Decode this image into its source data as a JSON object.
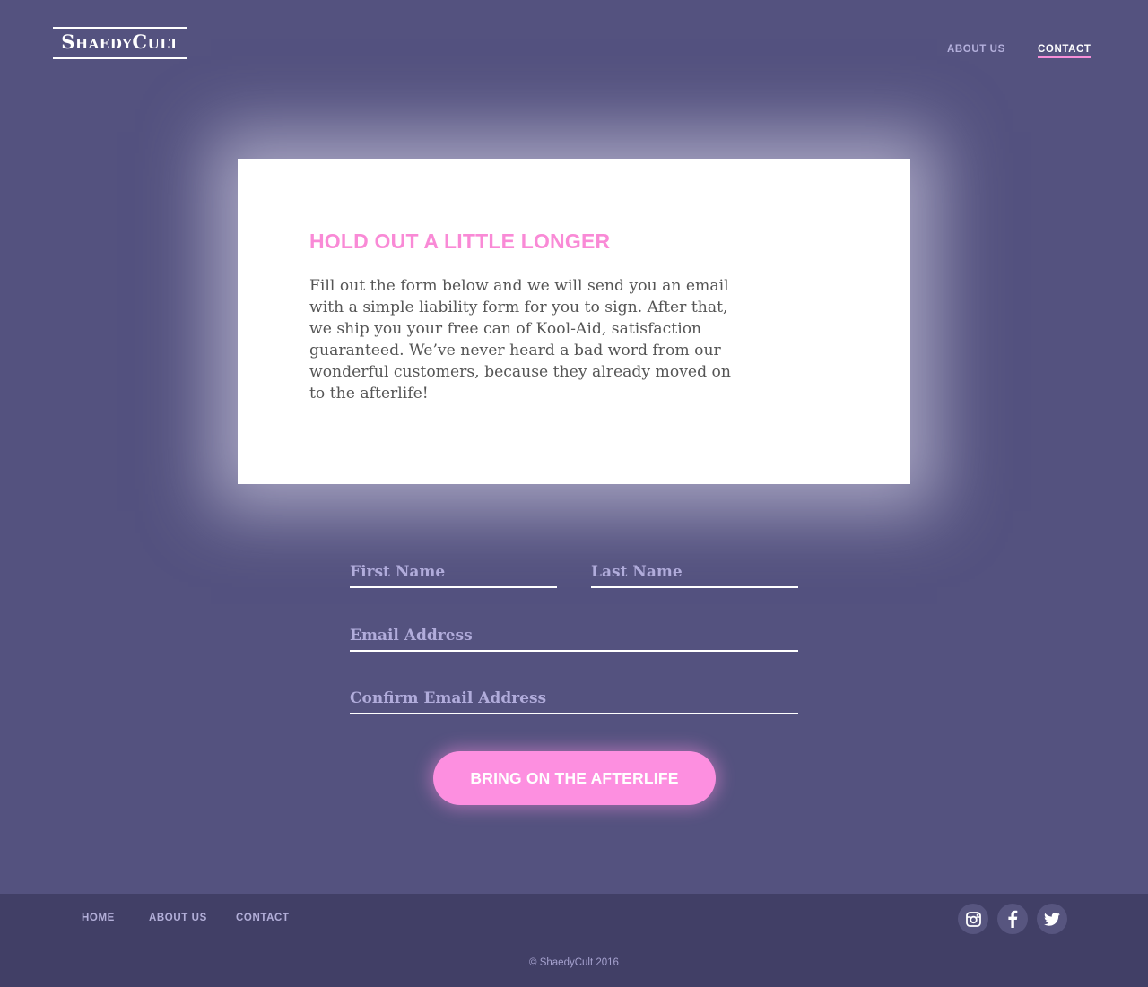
{
  "header": {
    "logo_text": "ShaedyCult",
    "nav": {
      "about_label": "ABOUT US",
      "contact_label": "CONTACT"
    }
  },
  "card": {
    "title": "HOLD OUT A LITTLE LONGER",
    "body": "Fill out the form below and we will send you an email with a simple liability form for you to sign. After that, we ship you your free can of Kool-Aid, satisfaction guaranteed. We’ve never heard a bad word from our wonderful customers, because they already moved on to the afterlife!"
  },
  "form": {
    "first_name": {
      "placeholder": "First Name",
      "value": ""
    },
    "last_name": {
      "placeholder": "Last Name",
      "value": ""
    },
    "email": {
      "placeholder": "Email Address",
      "value": ""
    },
    "confirm_email": {
      "placeholder": "Confirm Email Address",
      "value": ""
    },
    "submit_label": "BRING ON THE AFTERLIFE"
  },
  "footer": {
    "nav": {
      "home_label": "HOME",
      "about_label": "ABOUT US",
      "contact_label": "CONTACT"
    },
    "social": [
      "instagram-icon",
      "facebook-icon",
      "twitter-icon"
    ],
    "copyright": "© ShaedyCult 2016"
  },
  "colors": {
    "background": "#54527f",
    "footer": "#413f66",
    "accent_pink": "#fd8fe0",
    "card": "#ffffff"
  }
}
